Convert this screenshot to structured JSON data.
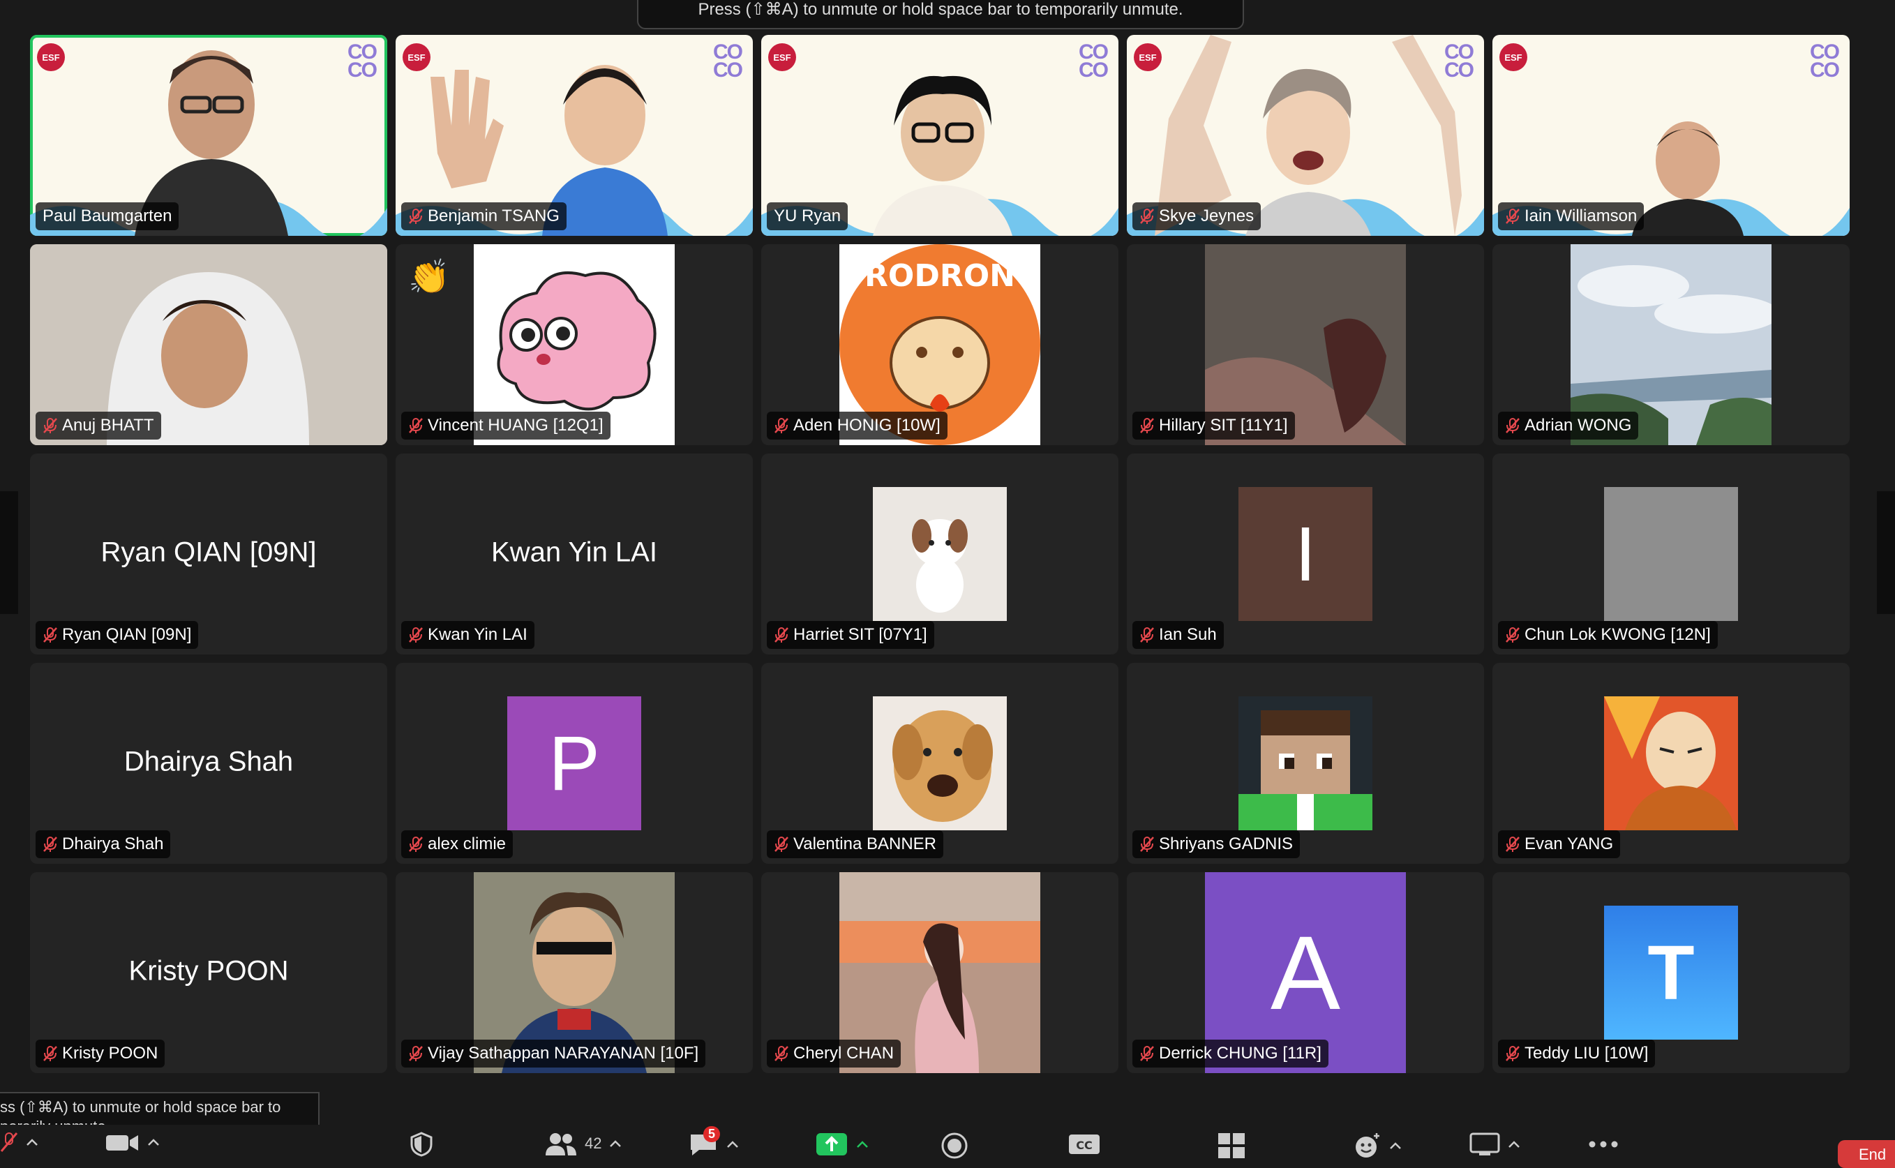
{
  "toasts": {
    "top": "Press (⇧⌘A) to unmute or hold space bar to temporarily unmute.",
    "bottom_line1": "ss (⇧⌘A) to unmute or hold space bar to",
    "bottom_line2": "porarily unmute."
  },
  "participants": [
    {
      "name": "Paul Baumgarten",
      "muted": false,
      "kind": "video",
      "active": true
    },
    {
      "name": "Benjamin TSANG",
      "muted": true,
      "kind": "video"
    },
    {
      "name": "YU Ryan",
      "muted": false,
      "kind": "video"
    },
    {
      "name": "Skye Jeynes",
      "muted": true,
      "kind": "video"
    },
    {
      "name": "Iain Williamson",
      "muted": true,
      "kind": "video"
    },
    {
      "name": "Anuj BHATT",
      "muted": true,
      "kind": "video"
    },
    {
      "name": "Vincent HUANG [12Q1]",
      "muted": true,
      "kind": "avatar",
      "reaction": "👏"
    },
    {
      "name": "Aden HONIG [10W]",
      "muted": true,
      "kind": "avatar",
      "avatar_text": "RODRON"
    },
    {
      "name": "Hillary SIT [11Y1]",
      "muted": true,
      "kind": "avatar"
    },
    {
      "name": "Adrian WONG",
      "muted": true,
      "kind": "avatar"
    },
    {
      "name": "Ryan QIAN [09N]",
      "muted": true,
      "kind": "name-only",
      "big_name": "Ryan QIAN [09N]"
    },
    {
      "name": "Kwan Yin LAI",
      "muted": true,
      "kind": "name-only",
      "big_name": "Kwan Yin LAI"
    },
    {
      "name": "Harriet SIT [07Y1]",
      "muted": true,
      "kind": "avatar"
    },
    {
      "name": "Ian Suh",
      "muted": true,
      "kind": "letter",
      "letter": "I",
      "color": "#5a3d34"
    },
    {
      "name": "Chun Lok KWONG [12N]",
      "muted": true,
      "kind": "letter",
      "letter": "",
      "color": "#8e8e8e"
    },
    {
      "name": "Dhairya Shah",
      "muted": true,
      "kind": "name-only",
      "big_name": "Dhairya Shah"
    },
    {
      "name": "alex climie",
      "muted": true,
      "kind": "letter",
      "letter": "P",
      "color": "#9b4ab8"
    },
    {
      "name": "Valentina BANNER",
      "muted": true,
      "kind": "avatar"
    },
    {
      "name": "Shriyans GADNIS",
      "muted": true,
      "kind": "avatar"
    },
    {
      "name": "Evan YANG",
      "muted": true,
      "kind": "avatar"
    },
    {
      "name": "Kristy POON",
      "muted": true,
      "kind": "name-only",
      "big_name": "Kristy POON"
    },
    {
      "name": "Vijay Sathappan NARAYANAN [10F]",
      "muted": true,
      "kind": "avatar"
    },
    {
      "name": "Cheryl CHAN",
      "muted": true,
      "kind": "avatar"
    },
    {
      "name": "Derrick CHUNG [11R]",
      "muted": true,
      "kind": "letter-big",
      "letter": "A",
      "color": "#7b4fc4"
    },
    {
      "name": "Teddy LIU [10W]",
      "muted": true,
      "kind": "letter",
      "letter": "T",
      "color": "#3aa0ff"
    }
  ],
  "toolbar": {
    "participants_count": "42",
    "chat_badge": "5",
    "end_label": "End"
  },
  "colors": {
    "active_speaker": "#22c55e",
    "mute_red": "#e5484d"
  }
}
